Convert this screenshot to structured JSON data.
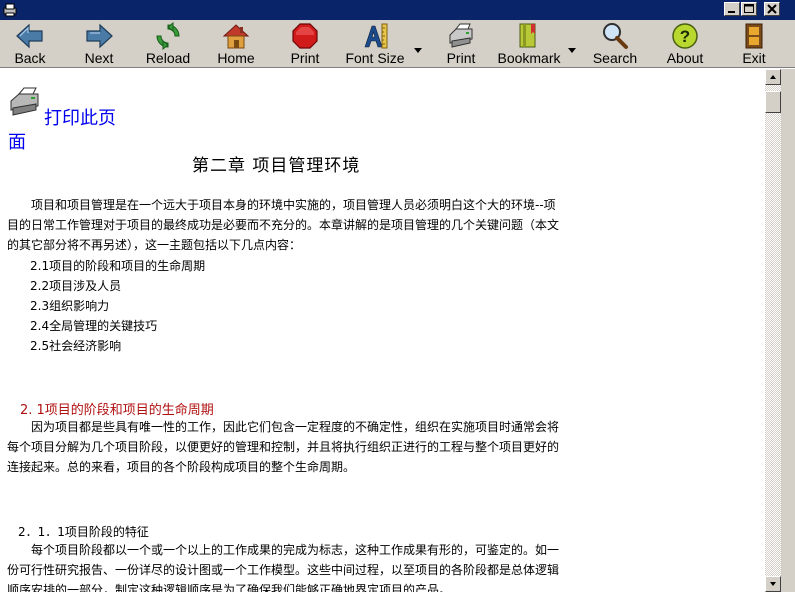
{
  "window": {
    "buttons": [
      "minimize",
      "maximize",
      "close"
    ]
  },
  "toolbar": {
    "items": [
      {
        "label": "Back",
        "icon": "back-arrow-icon"
      },
      {
        "label": "Next",
        "icon": "next-arrow-icon"
      },
      {
        "label": "Reload",
        "icon": "reload-icon"
      },
      {
        "label": "Home",
        "icon": "home-icon"
      },
      {
        "label": "Print",
        "icon": "stop-icon"
      },
      {
        "label": "Font Size",
        "icon": "font-size-icon",
        "dropdown": true
      },
      {
        "label": "Print",
        "icon": "printer-icon"
      },
      {
        "label": "Bookmark",
        "icon": "bookmark-icon",
        "dropdown": true
      },
      {
        "label": "Search",
        "icon": "magnifier-icon"
      },
      {
        "label": "About",
        "icon": "help-icon"
      },
      {
        "label": "Exit",
        "icon": "exit-icon"
      }
    ]
  },
  "content": {
    "print_link_line1": "打印此页",
    "print_link_line2": "面",
    "chapter_title": "第二章  项目管理环境",
    "intro_line1": "项目和项目管理是在一个远大于项目本身的环境中实施的，项目管理人员必须明白这个大的环境--项",
    "intro_line2": "目的日常工作管理对于项目的最终成功是必要而不充分的。本章讲解的是项目管理的几个关键问题（本文",
    "intro_line3": "的其它部分将不再另述），这一主题包括以下几点内容：",
    "toc": [
      "2.1项目的阶段和项目的生命周期",
      "2.2项目涉及人员",
      "2.3组织影响力",
      "2.4全局管理的关键技巧",
      "2.5社会经济影响"
    ],
    "section_2_1_heading": "2. 1项目的阶段和项目的生命周期",
    "section_2_1_line1": "因为项目都是些具有唯一性的工作，因此它们包含一定程度的不确定性，组织在实施项目时通常会将",
    "section_2_1_line2": "每个项目分解为几个项目阶段，以便更好的管理和控制，并且将执行组织正进行的工程与整个项目更好的",
    "section_2_1_line3": "连接起来。总的来看，项目的各个阶段构成项目的整个生命周期。",
    "subsection_heading": "2．1．1项目阶段的特征",
    "subsection_line1": "每个项目阶段都以一个或一个以上的工作成果的完成为标志，这种工作成果有形的，可鉴定的。如一",
    "subsection_line2": "份可行性研究报告、一份详尽的设计图或一个工作模型。这些中间过程，以至项目的各阶段都是总体逻辑",
    "subsection_line3": "顺序安排的一部分，制定这种逻辑顺序是为了确保我们能够正确地界定项目的产品。"
  },
  "colors": {
    "titlebar": "#0a246a",
    "chrome": "#d4d0c8",
    "link": "#0000ee",
    "section_heading": "#b01010"
  }
}
